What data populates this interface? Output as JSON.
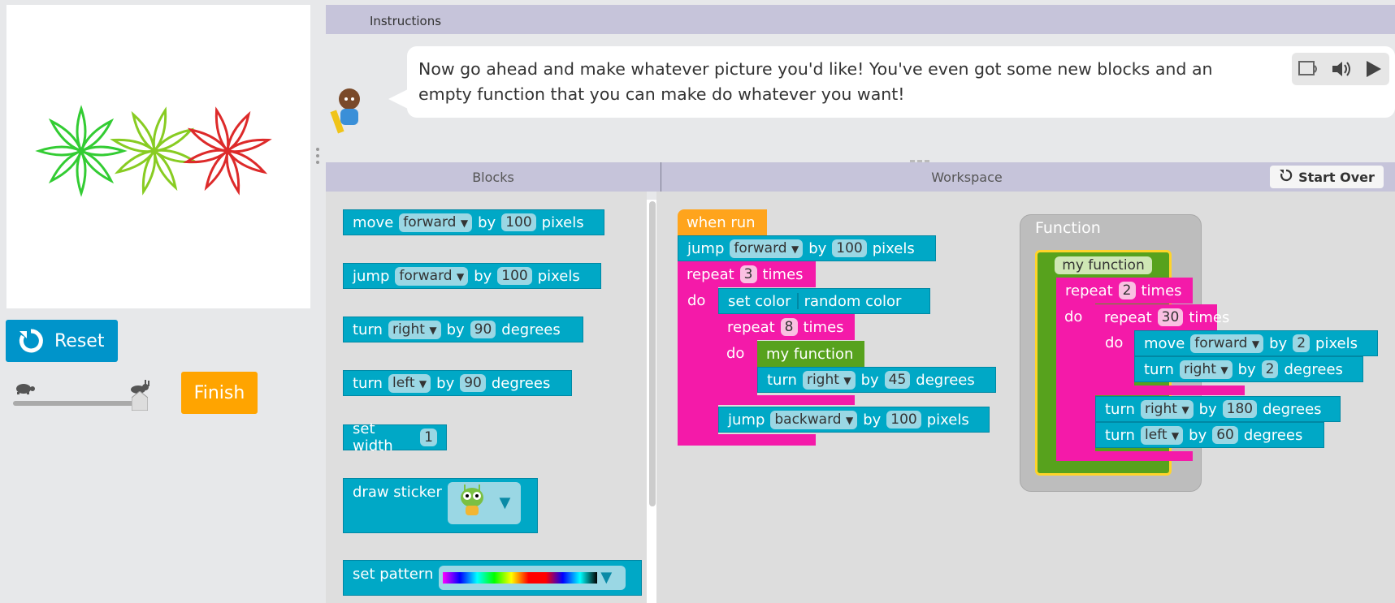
{
  "instructions_tab": "Instructions",
  "instruction_text": "Now go ahead and make whatever picture you'd like! You've even got some new blocks and an empty function that you can make do whatever you want!",
  "buttons": {
    "reset": "Reset",
    "finish": "Finish",
    "start_over": "Start Over"
  },
  "headers": {
    "blocks": "Blocks",
    "workspace": "Workspace"
  },
  "function_label": "Function",
  "colors": {
    "teal": "#00a8c6",
    "pink": "#f41aa9",
    "green": "#57a21d",
    "orange": "#ffa41c",
    "reset": "#0094ca",
    "finish": "#ffa400"
  },
  "toolbox": {
    "move": [
      "move",
      "forward",
      "by",
      "100",
      "pixels"
    ],
    "jump": [
      "jump",
      "forward",
      "by",
      "100",
      "pixels"
    ],
    "turn_right": [
      "turn",
      "right",
      "by",
      "90",
      "degrees"
    ],
    "turn_left": [
      "turn",
      "left",
      "by",
      "90",
      "degrees"
    ],
    "set_width": [
      "set width",
      "1"
    ],
    "draw_sticker": "draw sticker",
    "set_pattern": "set pattern"
  },
  "workspace": {
    "when_run": "when run",
    "jump1": [
      "jump",
      "forward",
      "by",
      "100",
      "pixels"
    ],
    "repeat1": [
      "repeat",
      "3",
      "times"
    ],
    "do": "do",
    "set_color": [
      "set color",
      "random color"
    ],
    "repeat2": [
      "repeat",
      "8",
      "times"
    ],
    "my_function": "my function",
    "turn1": [
      "turn",
      "right",
      "by",
      "45",
      "degrees"
    ],
    "jump2": [
      "jump",
      "backward",
      "by",
      "100",
      "pixels"
    ]
  },
  "function_def": {
    "name": "my function",
    "repeat_a": [
      "repeat",
      "2",
      "times"
    ],
    "repeat_b": [
      "repeat",
      "30",
      "times"
    ],
    "move": [
      "move",
      "forward",
      "by",
      "2",
      "pixels"
    ],
    "turn_a": [
      "turn",
      "right",
      "by",
      "2",
      "degrees"
    ],
    "turn_b": [
      "turn",
      "right",
      "by",
      "180",
      "degrees"
    ],
    "turn_c": [
      "turn",
      "left",
      "by",
      "60",
      "degrees"
    ]
  },
  "speed_slider_level": 1.0
}
